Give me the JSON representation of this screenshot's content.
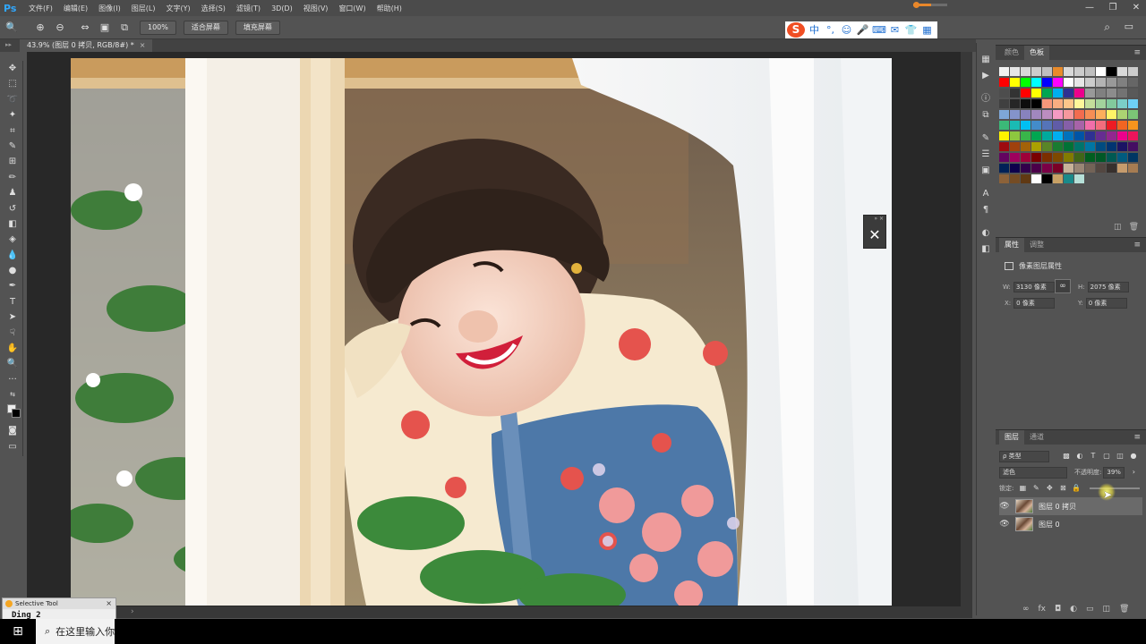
{
  "app": {
    "logo": "Ps",
    "menu": [
      "文件(F)",
      "编辑(E)",
      "图像(I)",
      "图层(L)",
      "文字(Y)",
      "选择(S)",
      "滤镜(T)",
      "3D(D)",
      "视图(V)",
      "窗口(W)",
      "帮助(H)"
    ],
    "window_controls": [
      "—",
      "❐",
      "✕"
    ]
  },
  "options_bar": {
    "zoom_value": "100%",
    "fit_screen_label": "适合屏幕",
    "fill_screen_label": "填充屏幕"
  },
  "ime": {
    "logo": "S",
    "chinese_label": "中"
  },
  "document": {
    "tab_title": "43.9% (图层 0 拷贝, RGB/8#) *",
    "close": "×"
  },
  "swatches_panel": {
    "tabs": [
      "颜色",
      "色板"
    ],
    "active_tab": 1,
    "colors": [
      "#f2f2f2",
      "#e6e6e6",
      "#d9d9d9",
      "#cccccc",
      "#bfbfbf",
      "#e88a2a",
      "#d9d9d9",
      "#cccccc",
      "#bfbfbf",
      "#ffffff",
      "#000000",
      "#d9d9d9",
      "#cccccc",
      "#ff0000",
      "#ffff00",
      "#00ff00",
      "#00ffff",
      "#0000ff",
      "#ff00ff",
      "#ffffff",
      "#e6e6e6",
      "#cccccc",
      "#b3b3b3",
      "#999999",
      "#808080",
      "#666666",
      "#4d4d4d",
      "#333333",
      "#ff0000",
      "#ffff00",
      "#00a651",
      "#00aeef",
      "#2e3192",
      "#ec008c",
      "#999999",
      "#808080",
      "#8c8c8c",
      "#737373",
      "#595959",
      "#404040",
      "#262626",
      "#0d0d0d",
      "#000000",
      "#f7977a",
      "#f9ad81",
      "#fdc68a",
      "#fff79a",
      "#c4df9b",
      "#a2d39c",
      "#82ca9d",
      "#7bcdc8",
      "#6ecff6",
      "#7ea7d8",
      "#8493ca",
      "#8882be",
      "#a187be",
      "#bc8dbf",
      "#f49ac2",
      "#f6989d",
      "#f26c4f",
      "#f68e55",
      "#fbaf5c",
      "#fff467",
      "#acd372",
      "#7cc576",
      "#3bb878",
      "#1abbb4",
      "#00bff3",
      "#438cca",
      "#5574b9",
      "#605ca8",
      "#855fa8",
      "#a763a8",
      "#f06ea9",
      "#f26d7d",
      "#ed1c24",
      "#f26522",
      "#f7941d",
      "#fff200",
      "#8dc73f",
      "#39b54a",
      "#00a651",
      "#00a99d",
      "#00aeef",
      "#0072bc",
      "#0054a6",
      "#2e3192",
      "#662d91",
      "#92278f",
      "#ec008c",
      "#ed145b",
      "#9e0b0f",
      "#a0410d",
      "#a36209",
      "#aba000",
      "#598527",
      "#1a7b30",
      "#007236",
      "#00746b",
      "#0076a3",
      "#004b80",
      "#003471",
      "#1b1464",
      "#440e62",
      "#630460",
      "#9e005d",
      "#9e0039",
      "#790000",
      "#7b2e00",
      "#7d4900",
      "#827b00",
      "#406618",
      "#005e20",
      "#005826",
      "#005952",
      "#005b7f",
      "#003663",
      "#002157",
      "#0d004c",
      "#32004b",
      "#4b0049",
      "#7b0046",
      "#7a0026",
      "#c7b299",
      "#998675",
      "#736357",
      "#534741",
      "#37302d",
      "#c69c6d",
      "#a67c52",
      "#8c6239",
      "#754c24",
      "#603913",
      "#ffffff",
      "#000000",
      "#c8a165",
      "#1a8a8a",
      "#b6e0d8"
    ]
  },
  "properties_panel": {
    "tabs": [
      "属性",
      "调整"
    ],
    "active_tab": 0,
    "title": "像素图层属性",
    "w_label": "W:",
    "w_value": "3130 像素",
    "h_label": "H:",
    "h_value": "2075 像素",
    "x_label": "X:",
    "x_value": "0 像素",
    "y_label": "Y:",
    "y_value": "0 像素",
    "link_icon": "∞"
  },
  "layers_panel": {
    "tabs": [
      "图层",
      "通道"
    ],
    "active_tab": 0,
    "filter_kind": "ρ 类型",
    "blend_mode": "滤色",
    "opacity_label": "不透明度:",
    "opacity_value": "39%",
    "lock_label": "锁定:",
    "layers": [
      {
        "name": "图层 0 拷贝",
        "visible": true,
        "selected": true
      },
      {
        "name": "图层 0",
        "visible": true,
        "selected": false
      }
    ],
    "footer_icons": [
      "∞",
      "fx",
      "◘",
      "◐",
      "▭",
      "◫",
      "🗑"
    ]
  },
  "selective_tool": {
    "title": "Selective Tool",
    "close": "×",
    "value": "Ding 2"
  },
  "taskbar": {
    "search_placeholder": "在这里输入你要搜索的内容"
  }
}
